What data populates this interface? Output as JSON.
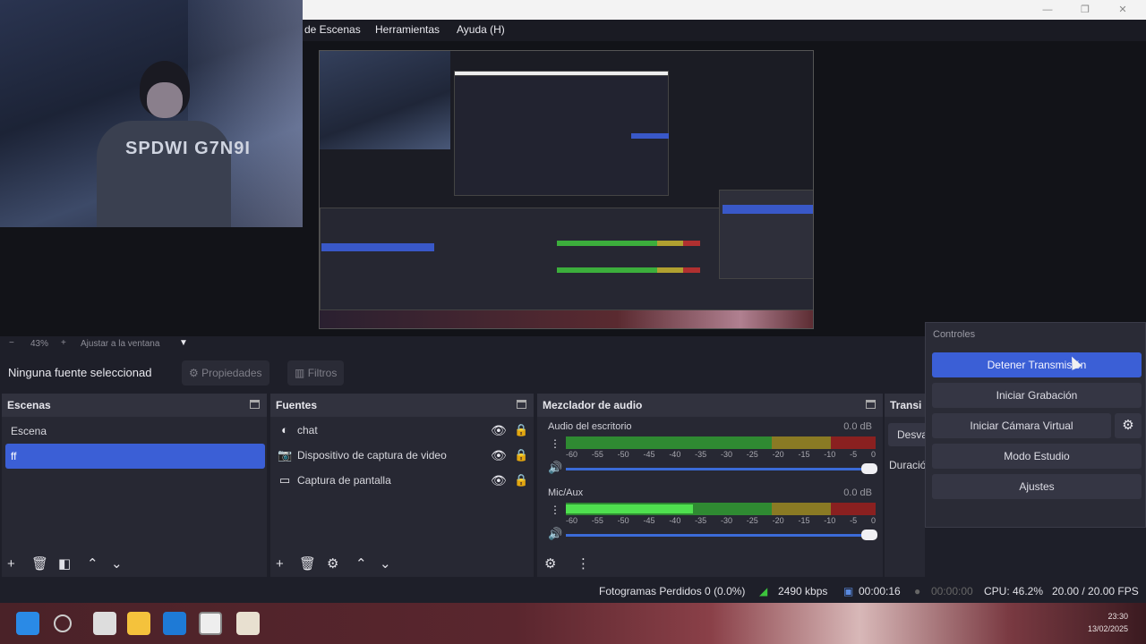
{
  "menu": {
    "items": [
      "de Escenas",
      "Herramientas",
      "Ayuda (H)"
    ]
  },
  "window_controls": {
    "minimize": "—",
    "maximize": "❐",
    "close": "✕"
  },
  "webcam": {
    "shirt_text": "SPDWI G7N9I"
  },
  "zoom": {
    "minus": "−",
    "percent": "43%",
    "plus": "+",
    "fit": "Ajustar a la ventana"
  },
  "source_toolbar": {
    "selected": "Ninguna fuente seleccionad",
    "properties": "Propiedades",
    "filters": "Filtros"
  },
  "scenes": {
    "title": "Escenas",
    "items": [
      "Escena",
      "ff"
    ],
    "selected_index": 1
  },
  "sources": {
    "title": "Fuentes",
    "items": [
      {
        "label": "chat",
        "icon": "browser-icon"
      },
      {
        "label": "Dispositivo de captura de video",
        "icon": "camera-icon"
      },
      {
        "label": "Captura de pantalla",
        "icon": "monitor-icon"
      }
    ]
  },
  "mixer": {
    "title": "Mezclador de audio",
    "channels": [
      {
        "name": "Audio del escritorio",
        "db": "0.0 dB",
        "level": 0
      },
      {
        "name": "Mic/Aux",
        "db": "0.0 dB",
        "level": 0.41
      }
    ],
    "ticks": [
      "-60",
      "-55",
      "-50",
      "-45",
      "-40",
      "-35",
      "-30",
      "-25",
      "-20",
      "-15",
      "-10",
      "-5",
      "0"
    ]
  },
  "transitions": {
    "title": "Transi",
    "value": "Desva",
    "duration": "Duració"
  },
  "controls": {
    "title": "Controles",
    "stop_stream": "Detener Transmisión",
    "start_recording": "Iniciar Grabación",
    "start_virtual_cam": "Iniciar Cámara Virtual",
    "studio_mode": "Modo Estudio",
    "settings": "Ajustes"
  },
  "status": {
    "dropped_frames": "Fotogramas Perdidos 0 (0.0%)",
    "bitrate": "2490 kbps",
    "stream_time": "00:00:16",
    "rec_time": "00:00:00",
    "cpu": "CPU: 46.2%",
    "fps": "20.00 / 20.00 FPS"
  },
  "taskbar": {
    "time": "23:30",
    "date": "13/02/2025"
  },
  "colors": {
    "accent": "#3b5fd6",
    "panel": "#272833",
    "background": "#1e1f29",
    "meter_green": "#2f8a32",
    "meter_yellow": "#8a7a24",
    "meter_red": "#8a2020"
  }
}
